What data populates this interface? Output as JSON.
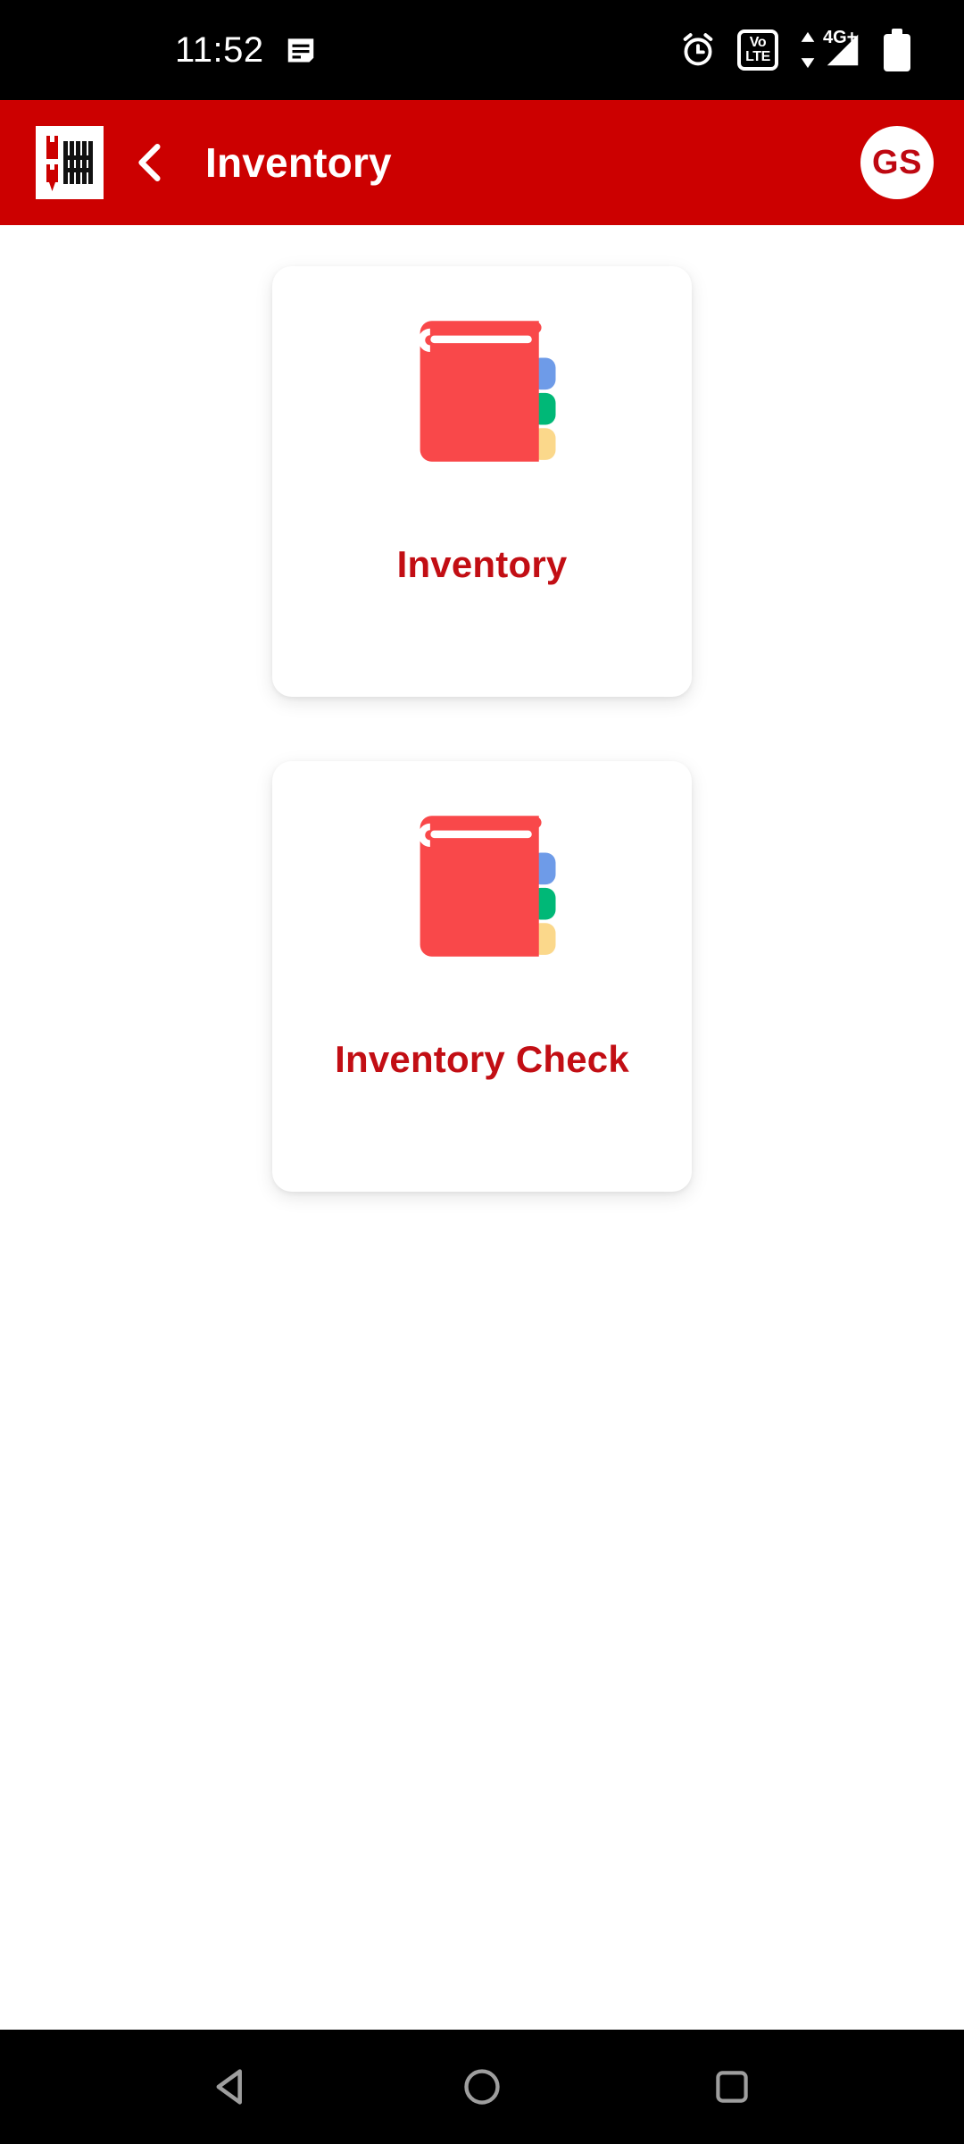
{
  "status_bar": {
    "clock": "11:52",
    "icons": {
      "notification": "message-icon",
      "alarm": "alarm-clock-icon",
      "volte_line1": "Vo",
      "volte_line2": "LTE",
      "data_transfer": "data-transfer-arrows-icon",
      "network_label": "4G+",
      "signal": "signal-bars-icon",
      "battery": "battery-icon"
    },
    "background": "#000000",
    "foreground": "#FFFFFF"
  },
  "app_bar": {
    "logo_alt": "wurth-logo",
    "logo_text": "WÜRTH",
    "back_label": "back-chevron-icon",
    "title": "Inventory",
    "avatar_initials": "GS",
    "background": "#CC0000",
    "title_color": "#FFFFFF",
    "avatar_bg": "#FFFFFF",
    "avatar_color": "#BE0811"
  },
  "main": {
    "background": "#FFFFFF",
    "tiles": [
      {
        "label": "Inventory",
        "icon": "book-icon",
        "label_color": "#C20E14"
      },
      {
        "label": "Inventory Check",
        "icon": "book-icon",
        "label_color": "#C20E14"
      }
    ]
  },
  "nav_bar": {
    "back": "back-triangle-icon",
    "home": "home-circle-icon",
    "recents": "recents-square-icon",
    "background": "#000000",
    "icon_color": "#9E9E9E"
  },
  "palette": {
    "brand_red": "#CC0000",
    "label_red": "#C20E14",
    "book_red": "#F9484A",
    "tab_blue": "#6E9BE8",
    "tab_green": "#00B877",
    "tab_yellow": "#FBD88B",
    "card_white": "#FFFFFF",
    "black": "#000000"
  }
}
